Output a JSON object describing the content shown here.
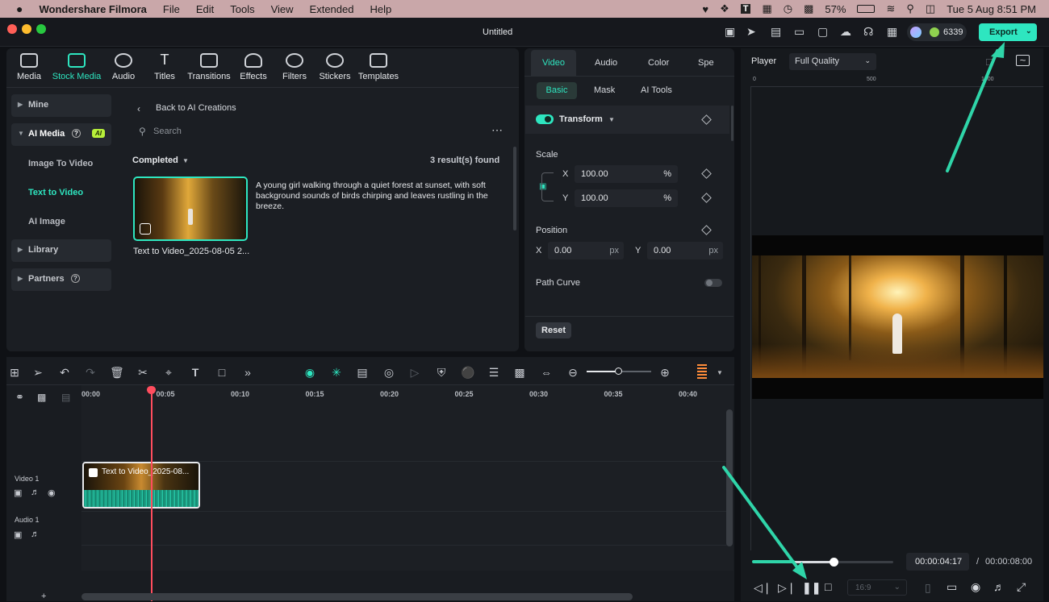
{
  "menubar": {
    "app": "Wondershare Filmora",
    "items": [
      "File",
      "Edit",
      "Tools",
      "View",
      "Extended",
      "Help"
    ],
    "battery": "57%",
    "clock": "Tue 5 Aug  8:51 PM"
  },
  "window": {
    "title": "Untitled",
    "credits": "6339",
    "export_label": "Export"
  },
  "media_tabs": [
    "Media",
    "Stock Media",
    "Audio",
    "Titles",
    "Transitions",
    "Effects",
    "Filters",
    "Stickers",
    "Templates"
  ],
  "sidebar": {
    "mine": "Mine",
    "ai_media": "AI Media",
    "ai_badge": "AI",
    "image_to_video": "Image To Video",
    "text_to_video": "Text to Video",
    "ai_image": "AI Image",
    "library": "Library",
    "partners": "Partners"
  },
  "browser": {
    "back": "Back to AI Creations",
    "search_placeholder": "Search",
    "filter": "Completed",
    "results": "3 result(s) found",
    "item_desc": "A young girl walking through a quiet forest at sunset, with soft background sounds of birds chirping and leaves rustling in the breeze.",
    "item_name": "Text to Video_2025-08-05 2..."
  },
  "props": {
    "tabs": [
      "Video",
      "Audio",
      "Color",
      "Spe"
    ],
    "subtabs": [
      "Basic",
      "Mask",
      "AI Tools"
    ],
    "transform": "Transform",
    "scale": "Scale",
    "x_label": "X",
    "y_label": "Y",
    "scale_x": "100.00",
    "scale_y": "100.00",
    "pct": "%",
    "position": "Position",
    "pos_x": "0.00",
    "pos_y": "0.00",
    "px": "px",
    "path_curve": "Path Curve",
    "reset": "Reset"
  },
  "player": {
    "label": "Player",
    "quality": "Full Quality",
    "ruler_0": "0",
    "ruler_500": "500",
    "ruler_1000": "1000",
    "current": "00:00:04:17",
    "sep": "/",
    "total": "00:00:08:00",
    "aspect": "16:9",
    "progress": 0.57
  },
  "timeline": {
    "ticks": [
      "00:00",
      "00:05",
      "00:10",
      "00:15",
      "00:20",
      "00:25",
      "00:30",
      "00:35",
      "00:40"
    ],
    "video_track": "Video 1",
    "audio_track": "Audio 1",
    "clip_name": "Text to Video_2025-08..."
  },
  "colors": {
    "accent": "#2ee6c0",
    "menubar": "#c9a7a9",
    "playhead": "#ff4d5e"
  }
}
